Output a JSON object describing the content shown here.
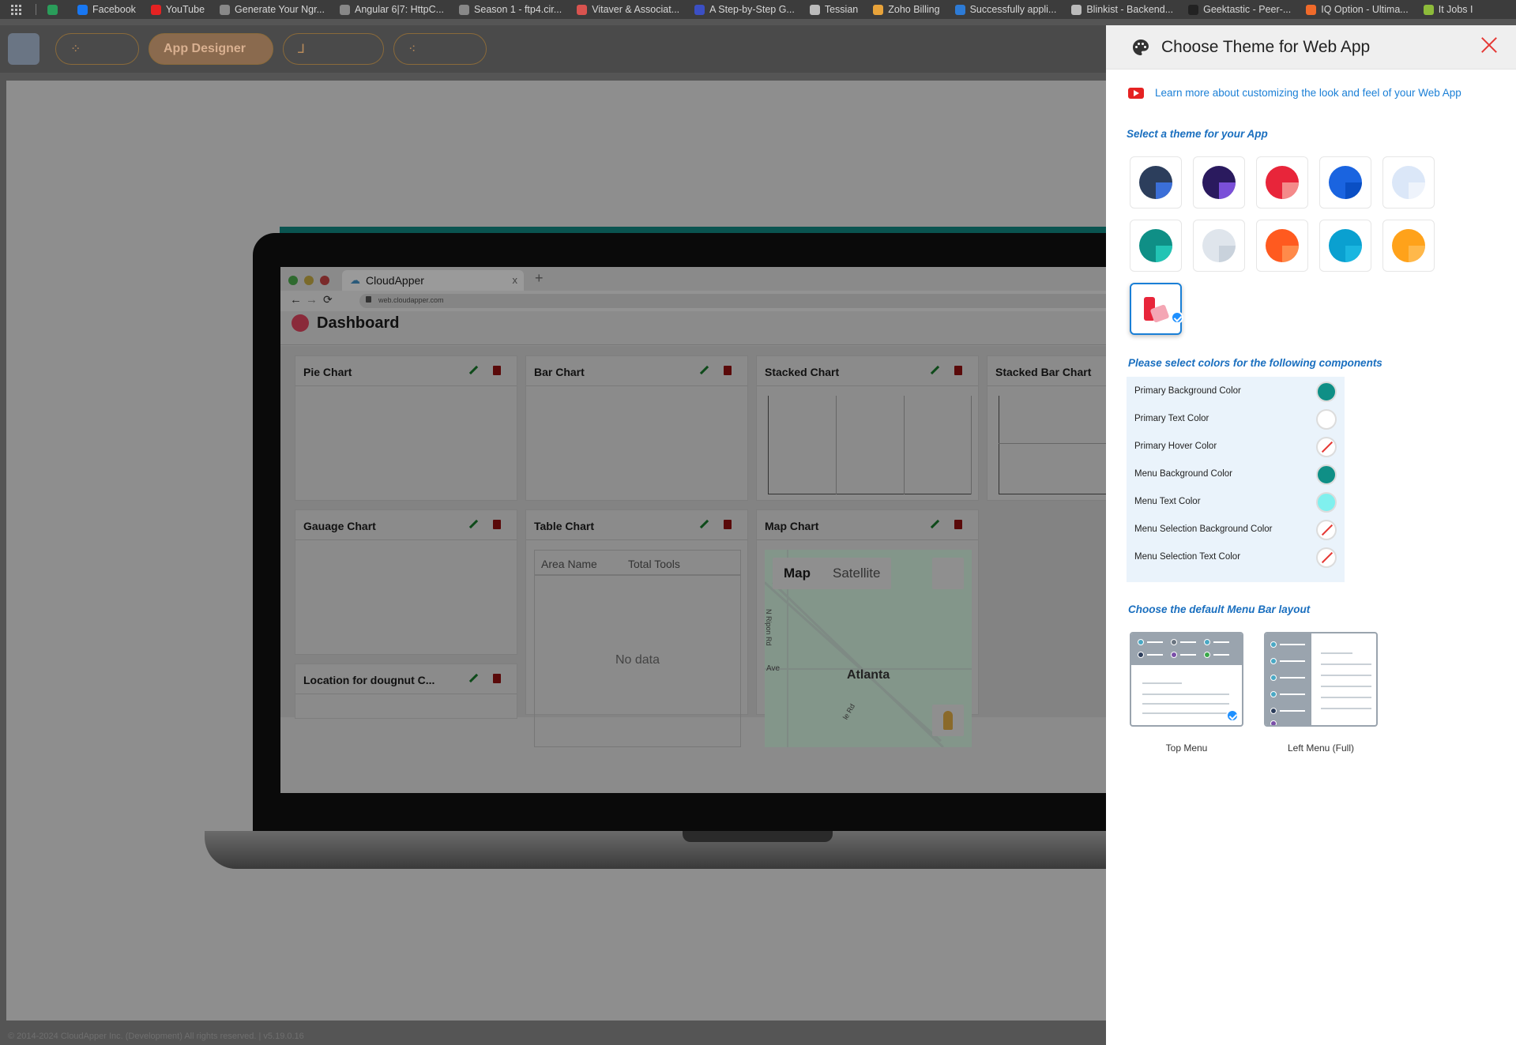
{
  "bookmarks": [
    {
      "label": "Facebook",
      "color": "#1877f2"
    },
    {
      "label": "YouTube",
      "color": "#e52222"
    },
    {
      "label": "Generate Your Ngr...",
      "color": "#888888"
    },
    {
      "label": "Angular 6|7: HttpC...",
      "color": "#888888"
    },
    {
      "label": "Season 1 - ftp4.cir...",
      "color": "#888888"
    },
    {
      "label": "Vitaver & Associat...",
      "color": "#d9534f"
    },
    {
      "label": "A Step-by-Step G...",
      "color": "#3b4fc4"
    },
    {
      "label": "Tessian",
      "color": "#bbbbbb"
    },
    {
      "label": "Zoho Billing",
      "color": "#e8a33a"
    },
    {
      "label": "Successfully appli...",
      "color": "#2d7bd6"
    },
    {
      "label": "Blinkist - Backend...",
      "color": "#bbbbbb"
    },
    {
      "label": "Geektastic - Peer-...",
      "color": "#222222"
    },
    {
      "label": "IQ Option - Ultima...",
      "color": "#f06a2a"
    },
    {
      "label": "It Jobs I",
      "color": "#8dbb3a"
    }
  ],
  "header": {
    "app_designer_label": "App Designer"
  },
  "footer": {
    "copyright": "© 2014-2024 CloudApper Inc. (Development) All rights reserved. | v5.19.0.16"
  },
  "preview": {
    "tab_title": "CloudApper",
    "tab_close": "x",
    "tab_plus": "+",
    "url": "web.cloudapper.com",
    "dashboard_title": "Dashboard",
    "cards": [
      {
        "title": "Pie Chart"
      },
      {
        "title": "Bar Chart"
      },
      {
        "title": "Stacked Chart"
      },
      {
        "title": "Stacked Bar Chart"
      },
      {
        "title": "Gauage Chart"
      },
      {
        "title": "Table Chart"
      },
      {
        "title": "Map Chart"
      },
      {
        "title": "Location for dougnut C..."
      }
    ],
    "table": {
      "col1": "Area Name",
      "col2": "Total Tools",
      "empty": "No data"
    },
    "map": {
      "map_btn": "Map",
      "satellite_btn": "Satellite",
      "city": "Atlanta",
      "street1": "N Ripon Rd",
      "street2": "Ave",
      "street3": "le Rd"
    }
  },
  "panel": {
    "title": "Choose Theme for Web App",
    "learn_more": "Learn more about customizing the look and feel of your Web App",
    "select_theme_label": "Select a theme for your App",
    "themes": [
      {
        "main": "#2c3e5c",
        "accent": "#3b6fd8"
      },
      {
        "main": "#2a1a5e",
        "accent": "#7a4fd8"
      },
      {
        "main": "#e8253a",
        "accent": "#f48a8a"
      },
      {
        "main": "#1a64e0",
        "accent": "#0a4fc4"
      },
      {
        "main": "#dbe7f8",
        "accent": "#eef3fb"
      },
      {
        "main": "#0f8f86",
        "accent": "#22c4b4"
      },
      {
        "main": "#dfe5ec",
        "accent": "#c9d2dc"
      },
      {
        "main": "#ff5a1f",
        "accent": "#ff8a4a"
      },
      {
        "main": "#0aa0d0",
        "accent": "#1ab6e0"
      },
      {
        "main": "#ffa21a",
        "accent": "#ffb84a"
      }
    ],
    "components_label": "Please select colors for the following components",
    "components": [
      {
        "label": "Primary Background Color",
        "color": "#0f8f86"
      },
      {
        "label": "Primary Text Color",
        "color": "#ffffff"
      },
      {
        "label": "Primary Hover Color",
        "color": "none"
      },
      {
        "label": "Menu Background Color",
        "color": "#0f8f86"
      },
      {
        "label": "Menu Text Color",
        "color": "#80f0ee"
      },
      {
        "label": "Menu Selection Background Color",
        "color": "none"
      },
      {
        "label": "Menu Selection Text Color",
        "color": "none"
      }
    ],
    "menu_layout_label": "Choose the default Menu Bar layout",
    "layouts": [
      {
        "label": "Top Menu",
        "selected": true
      },
      {
        "label": "Left Menu (Full)",
        "selected": false
      }
    ]
  }
}
